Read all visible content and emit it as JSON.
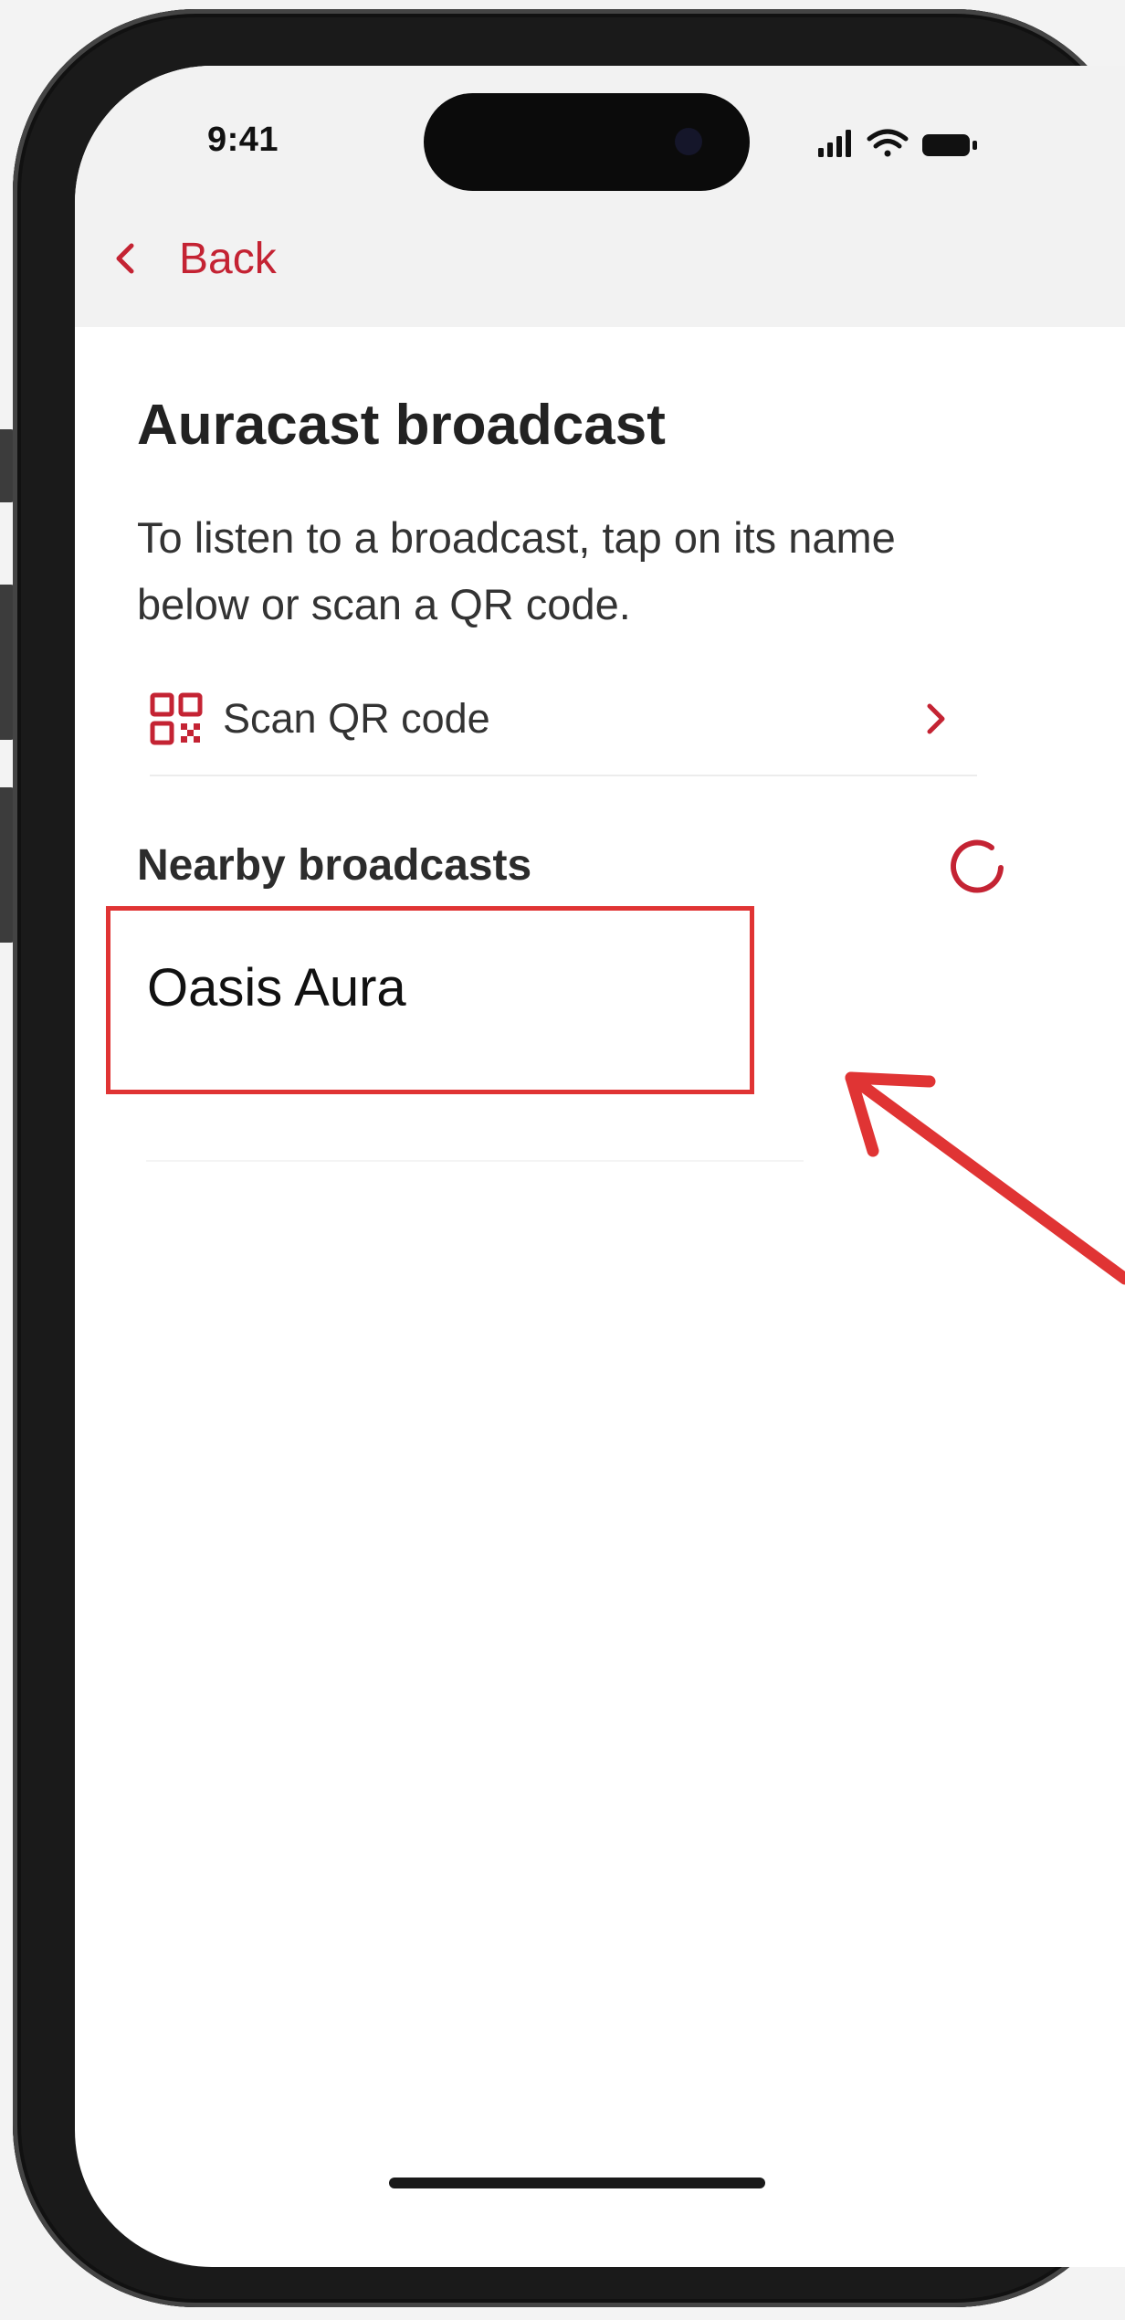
{
  "status_bar": {
    "time": "9:41",
    "icons": [
      "signal-bars-icon",
      "wifi-icon",
      "battery-icon"
    ]
  },
  "nav": {
    "back_label": "Back",
    "back_icon": "chevron-left-icon"
  },
  "main": {
    "title": "Auracast broadcast",
    "instruction": "To listen to a broadcast, tap on its name below or scan a QR code.",
    "scan": {
      "label": "Scan QR code",
      "icon": "qr-code-icon",
      "chevron_icon": "chevron-right-icon"
    },
    "nearby": {
      "heading": "Nearby broadcasts",
      "spinner_icon": "loading-spinner-icon",
      "items": [
        {
          "name": "Oasis Aura"
        }
      ]
    }
  },
  "annotation": {
    "highlight_color": "#e03434",
    "arrow_icon": "pointer-arrow-icon"
  },
  "colors": {
    "accent": "#c42333",
    "annotation": "#e03434"
  }
}
